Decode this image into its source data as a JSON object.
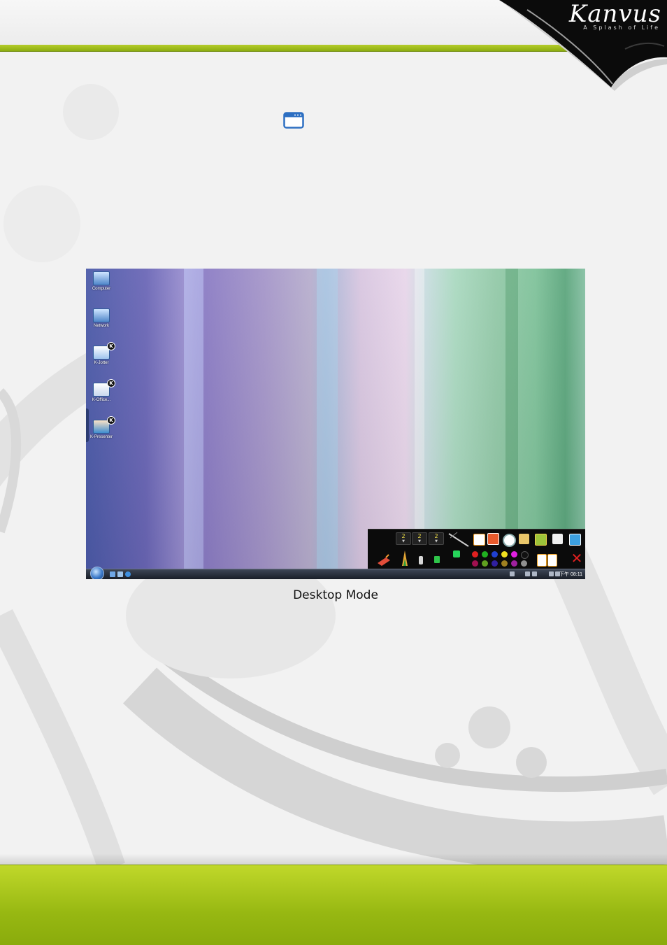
{
  "brand": {
    "name": "Kanvus",
    "tagline": "A Splash of Life"
  },
  "figure": {
    "caption": "Desktop Mode",
    "desktop_icons": [
      {
        "label": "Computer",
        "icon": "computer-icon"
      },
      {
        "label": "Network",
        "icon": "network-icon"
      },
      {
        "label": "K-Jotter",
        "icon": "k-jotter-icon"
      },
      {
        "label": "K-Office...",
        "icon": "k-office-icon"
      },
      {
        "label": "K-Presenter",
        "icon": "k-presenter-icon"
      }
    ],
    "toolbar": {
      "counters": [
        "2",
        "2",
        "2"
      ],
      "close_symbol": "✕",
      "pen_colors_row1": [
        "#e02020",
        "#20b020",
        "#2040d0",
        "#f0e020",
        "#e020e0",
        "#111111"
      ],
      "pen_colors_row2": [
        "#a01050",
        "#60a020",
        "#3020a0",
        "#a08020",
        "#a020a0",
        "#909090"
      ]
    },
    "taskbar": {
      "clock": "下午 08:11"
    }
  },
  "colors": {
    "accent_green": "#9dbb14",
    "toolbar_bg": "#0b0b0b"
  }
}
